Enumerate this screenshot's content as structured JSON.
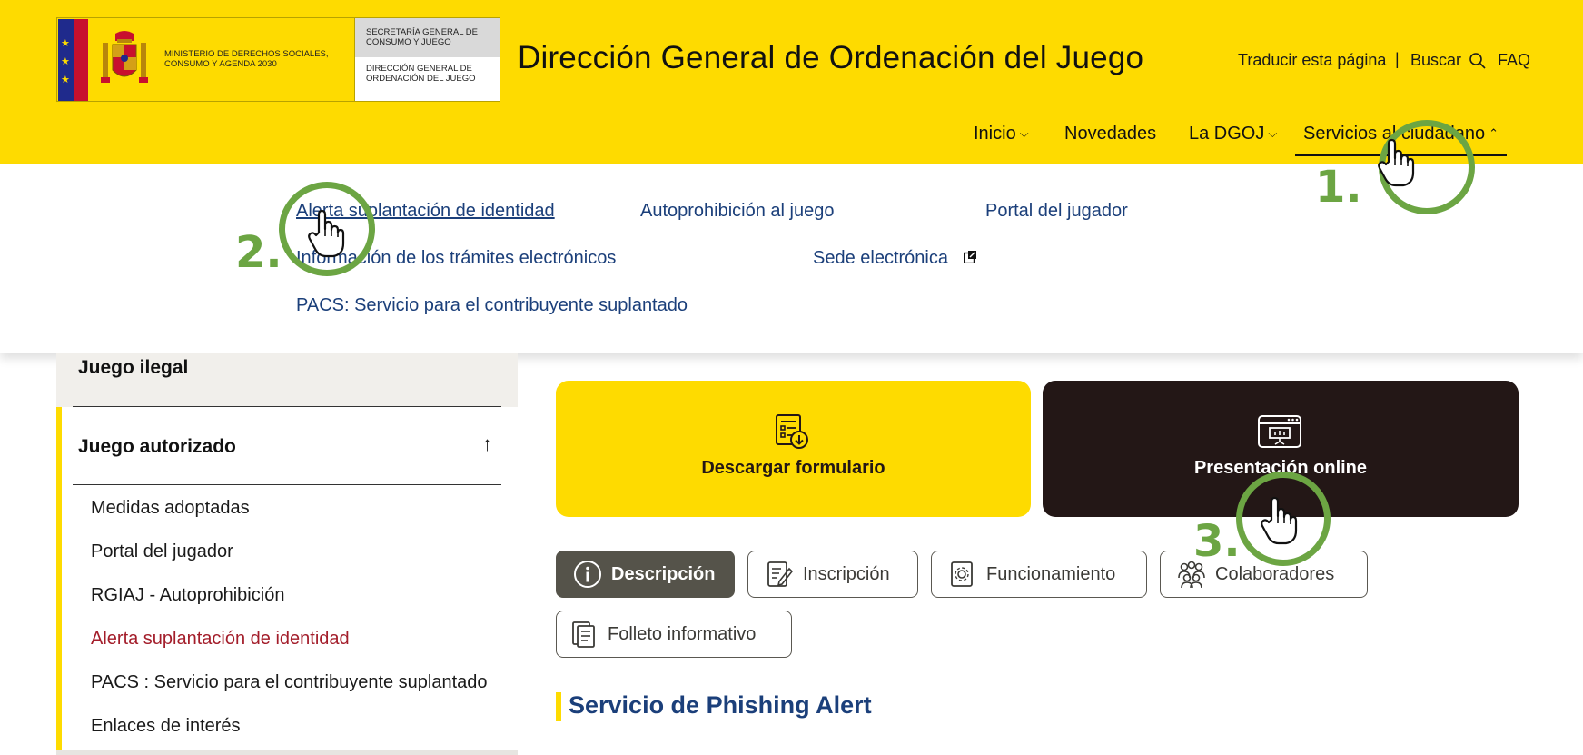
{
  "header": {
    "ministry": "MINISTERIO DE DERECHOS SOCIALES, CONSUMO Y AGENDA 2030",
    "secretaria": "SECRETARÍA GENERAL DE CONSUMO Y JUEGO",
    "direccion_logo": "DIRECCIÓN GENERAL DE ORDENACIÓN DEL JUEGO",
    "site_title": "Dirección General de Ordenación del Juego",
    "utility": {
      "translate": "Traducir esta página",
      "separator": "|",
      "search": "Buscar",
      "faq": "FAQ"
    },
    "nav": [
      {
        "label": "Inicio",
        "chevron": "⌵"
      },
      {
        "label": "Novedades",
        "chevron": ""
      },
      {
        "label": "La DGOJ",
        "chevron": "⌵"
      },
      {
        "label": "Servicios al ciudadano",
        "chevron": "⌃",
        "active": true
      }
    ]
  },
  "dropdown": {
    "links": [
      "Alerta suplantación de identidad",
      "Autoprohibición al juego",
      "Portal del jugador",
      "Información de los trámites electrónicos",
      "Sede electrónica",
      "PACS: Servicio para el contribuyente suplantado"
    ]
  },
  "sidebar": {
    "section_illegal": "Juego ilegal",
    "section_authorized": "Juego autorizado",
    "toggle_icon": "↑",
    "items": [
      {
        "label": "Medidas adoptadas"
      },
      {
        "label": "Portal del jugador"
      },
      {
        "label": "RGIAJ - Autoprohibición"
      },
      {
        "label": "Alerta suplantación de identidad",
        "active": true
      },
      {
        "label": "PACS : Servicio para el contribuyente suplantado"
      },
      {
        "label": "Enlaces de interés"
      }
    ]
  },
  "cards": {
    "download": "Descargar formulario",
    "online": "Presentación online"
  },
  "tabs": [
    {
      "label": "Descripción",
      "icon": "info-icon",
      "active": true
    },
    {
      "label": "Inscripción",
      "icon": "form-icon"
    },
    {
      "label": "Funcionamiento",
      "icon": "gear-document-icon"
    },
    {
      "label": "Colaboradores",
      "icon": "people-icon"
    },
    {
      "label": "Folleto informativo",
      "icon": "brochure-icon"
    }
  ],
  "section_title": "Servicio de Phishing Alert",
  "annotations": {
    "step1": "1.",
    "step2": "2.",
    "step3": "3."
  },
  "colors": {
    "brand_yellow": "#FEDB00",
    "link_blue": "#1b3f7a",
    "active_red": "#a31d2a",
    "annotation_green": "#6ca543",
    "dark_card": "#231716"
  }
}
